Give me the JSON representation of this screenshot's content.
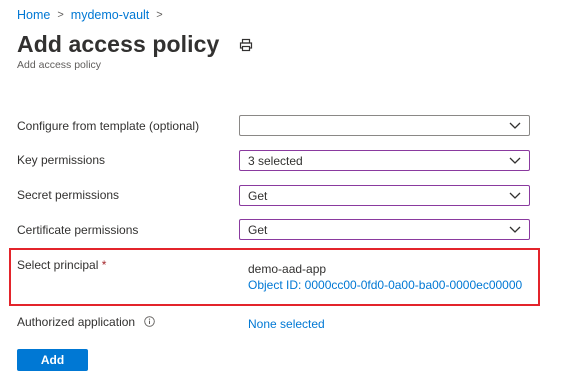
{
  "breadcrumb": {
    "items": [
      "Home",
      "mydemo-vault"
    ],
    "separator": ">"
  },
  "header": {
    "title": "Add access policy",
    "subtitle": "Add access policy",
    "print_icon": "print-icon"
  },
  "form": {
    "template": {
      "label": "Configure from template (optional)",
      "value": ""
    },
    "key_permissions": {
      "label": "Key permissions",
      "value": "3 selected"
    },
    "secret_permissions": {
      "label": "Secret permissions",
      "value": "Get"
    },
    "certificate_permissions": {
      "label": "Certificate permissions",
      "value": "Get"
    },
    "principal": {
      "label": "Select principal",
      "required_marker": "*",
      "name": "demo-aad-app",
      "object_id": "Object ID: 0000cc00-0fd0-0a00-ba00-0000ec00000"
    },
    "authorized_application": {
      "label": "Authorized application",
      "value": "None selected",
      "info_icon": "info-icon"
    }
  },
  "actions": {
    "add_label": "Add"
  },
  "colors": {
    "accent": "#0078d4",
    "focus_border": "#8a3a9f",
    "highlight": "#e3242b"
  }
}
